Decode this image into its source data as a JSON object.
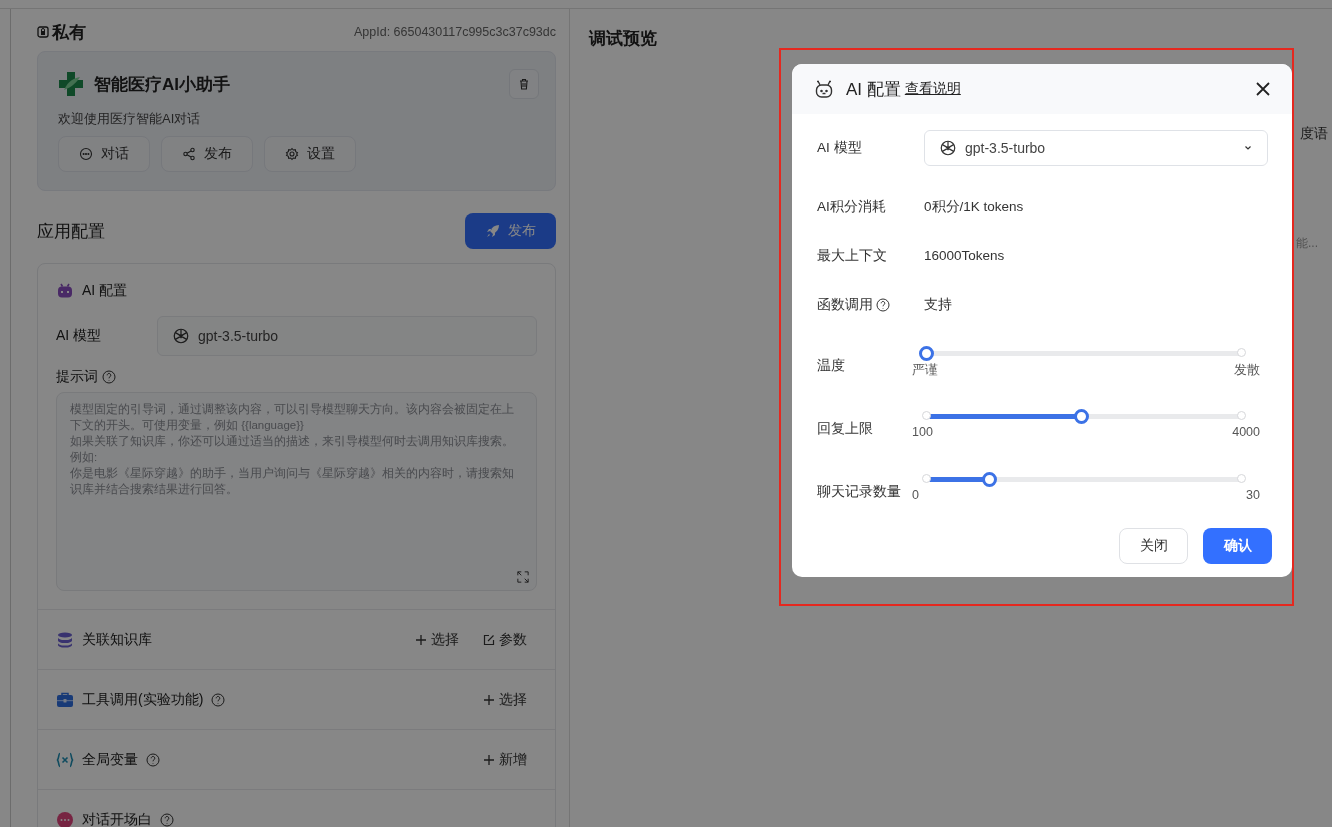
{
  "left": {
    "visibility": "私有",
    "app_id": "AppId: 6650430117c995c3c37c93dc",
    "app": {
      "name": "智能医疗AI小助手",
      "intro": "欢迎使用医疗智能AI对话",
      "actions": [
        {
          "kind": "chat",
          "label": "对话"
        },
        {
          "kind": "share",
          "label": "发布"
        },
        {
          "kind": "settings",
          "label": "设置"
        }
      ]
    },
    "section_title": "应用配置",
    "publish_button": "发布",
    "ai_config": {
      "title": "AI 配置",
      "model_label": "AI 模型",
      "model": "gpt-3.5-turbo",
      "prompt_label": "提示词",
      "prompt_placeholder": "模型固定的引导词，通过调整该内容，可以引导模型聊天方向。该内容会被固定在上下文的开头。可使用变量，例如 {{language}}\n如果关联了知识库，你还可以通过适当的描述，来引导模型何时去调用知识库搜索。例如:\n你是电影《星际穿越》的助手，当用户询问与《星际穿越》相关的内容时，请搜索知识库并结合搜索结果进行回答。"
    },
    "modules": [
      {
        "kind": "dataset",
        "title": "关联知识库",
        "help": false,
        "actions": [
          {
            "kind": "add",
            "label": "选择"
          },
          {
            "kind": "edit",
            "label": "参数"
          }
        ]
      },
      {
        "kind": "tools",
        "title": "工具调用(实验功能)",
        "help": true,
        "actions": [
          {
            "kind": "add",
            "label": "选择"
          }
        ]
      },
      {
        "kind": "variables",
        "title": "全局变量",
        "help": true,
        "actions": [
          {
            "kind": "add",
            "label": "新增"
          }
        ]
      },
      {
        "kind": "welcome",
        "title": "对话开场白",
        "help": true
      }
    ]
  },
  "preview": {
    "title": "调试预览",
    "fragments": [
      {
        "kind": "title",
        "text": "度语"
      },
      {
        "kind": "desc",
        "text": "能..."
      }
    ]
  },
  "dialog": {
    "title": "AI 配置",
    "help_link": "查看说明",
    "model_label": "AI 模型",
    "model": "gpt-3.5-turbo",
    "info": [
      {
        "label": "AI积分消耗",
        "help": false,
        "value": "0积分/1K tokens"
      },
      {
        "label": "最大上下文",
        "help": false,
        "value": "16000Tokens"
      },
      {
        "label": "函数调用",
        "help": true,
        "value": "支持"
      }
    ],
    "sliders": [
      {
        "label": "温度",
        "level": 0,
        "min_label": "严谨",
        "max_label": "发散"
      },
      {
        "label": "回复上限",
        "level": 0.49,
        "min_label": "100",
        "max_label": "4000"
      },
      {
        "label": "聊天记录数量",
        "level": 0.2,
        "min_label": "0",
        "max_label": "30"
      }
    ],
    "buttons": [
      {
        "kind": "secondary",
        "label": "关闭"
      },
      {
        "kind": "primary",
        "label": "确认"
      }
    ]
  }
}
